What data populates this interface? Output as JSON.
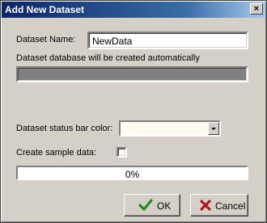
{
  "window": {
    "title": "Add New Dataset",
    "close_glyph": "×"
  },
  "form": {
    "name_label": "Dataset Name:",
    "name_value": "NewData",
    "db_note": "Dataset database will be created automatically",
    "status_color_label": "Dataset status bar color:",
    "status_color": "#fffbf0",
    "sample_label": "Create sample data:",
    "sample_checked": false
  },
  "progress": {
    "value": 0,
    "text": "0%"
  },
  "buttons": {
    "ok": {
      "label": "OK",
      "icon": "check-icon",
      "icon_color": "#1e8c1e"
    },
    "cancel": {
      "label": "Cancel",
      "icon": "x-icon",
      "icon_color": "#b01818"
    }
  },
  "colors": {
    "title_bar": "#0a246a",
    "dialog_bg": "#d4d0c8",
    "db_bar": "#808080"
  }
}
